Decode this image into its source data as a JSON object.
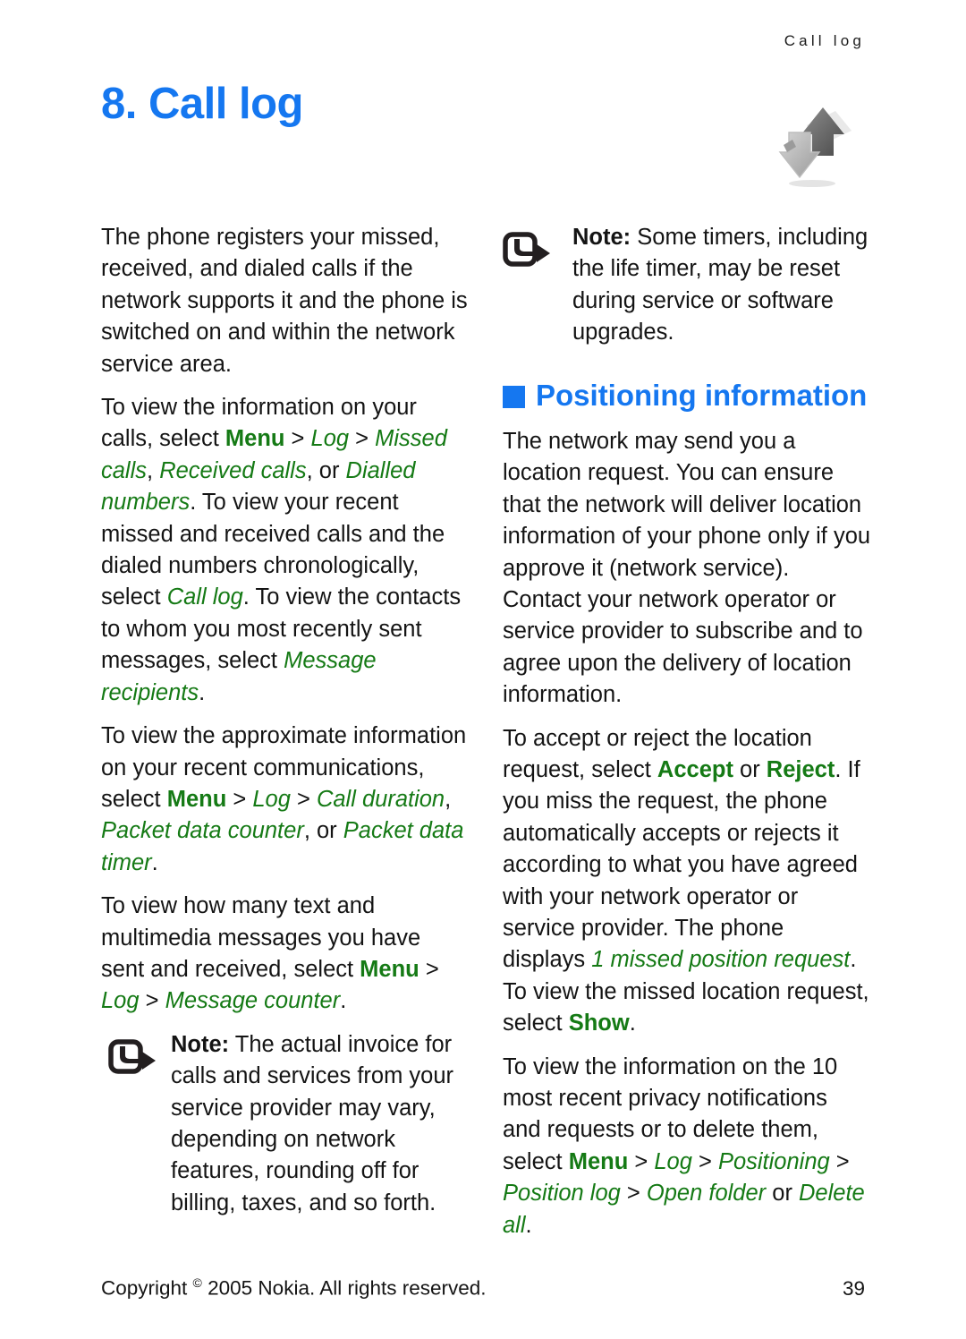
{
  "colors": {
    "heading_blue": "#1577f0",
    "gui_green": "#157a15",
    "body_text": "#141414"
  },
  "header": {
    "running_head": "Call log"
  },
  "title": {
    "text": "8. Call log"
  },
  "icons": {
    "chapter": "call-log-arrows-icon",
    "note": "note-arrow-icon",
    "section_bullet": "blue-square-bullet-icon"
  },
  "left_column": {
    "para1": "The phone registers your missed, received, and dialed calls if the network supports it and the phone is switched on and within the network service area.",
    "para2": {
      "t1": "To view the information on your calls, select ",
      "gui1": "Menu",
      "s1": " > ",
      "p1": "Log",
      "s2": " > ",
      "p2": "Missed calls",
      "t2": ", ",
      "p3": "Received calls",
      "t3": ", or ",
      "p4": "Dialled numbers",
      "t4": ". To view your recent missed and received calls and the dialed numbers chronologically, select ",
      "p5": "Call log",
      "t5": ". To view the contacts to whom you most recently sent messages, select ",
      "p6": "Message recipients",
      "t6": "."
    },
    "para3": {
      "t1": "To view the approximate information on your recent communications, select ",
      "gui1": "Menu",
      "s1": " > ",
      "p1": "Log",
      "s2": " > ",
      "p2": "Call duration",
      "t2": ", ",
      "p3": "Packet data counter",
      "t3": ", or ",
      "p4": "Packet data timer",
      "t4": "."
    },
    "para4": {
      "t1": "To view how many text and multimedia messages you have sent and received, select ",
      "gui1": "Menu",
      "s1": " > ",
      "p1": "Log",
      "s2": " > ",
      "p2": "Message counter",
      "t2": "."
    },
    "note": {
      "label": "Note:",
      "text": " The actual invoice for calls and services from your service provider may vary, depending on network features, rounding off for billing, taxes, and so forth."
    }
  },
  "right_column": {
    "note": {
      "label": "Note:",
      "text": " Some timers, including the life timer, may be reset during service or software upgrades."
    },
    "section_heading": "Positioning information",
    "para1": "The network may send you a location request. You can ensure that the network will deliver location information of your phone only if you approve it (network service). Contact your network operator or service provider to subscribe and to agree upon the delivery of location information.",
    "para2": {
      "t1": "To accept or reject the location request, select ",
      "gui1": "Accept",
      "t2": " or ",
      "gui2": "Reject",
      "t3": ". If you miss the request, the phone automatically accepts or rejects it according to what you have agreed with your network operator or service provider. The phone displays ",
      "p1": "1 missed position request",
      "t4": ". To view the missed location request, select ",
      "gui3": "Show",
      "t5": "."
    },
    "para3": {
      "t1": "To view the information on the 10 most recent privacy notifications and requests or to delete them, select ",
      "gui1": "Menu",
      "s1": " > ",
      "p1": "Log",
      "s2": " > ",
      "p2": "Positioning",
      "s3": " > ",
      "p3": "Position log",
      "s4": " > ",
      "p4": "Open folder",
      "t2": " or ",
      "p5": "Delete all",
      "t3": "."
    }
  },
  "footer": {
    "copyright_pre": "Copyright ",
    "copyright_symbol": "©",
    "copyright_post": " 2005 Nokia. All rights reserved.",
    "page_number": "39"
  }
}
